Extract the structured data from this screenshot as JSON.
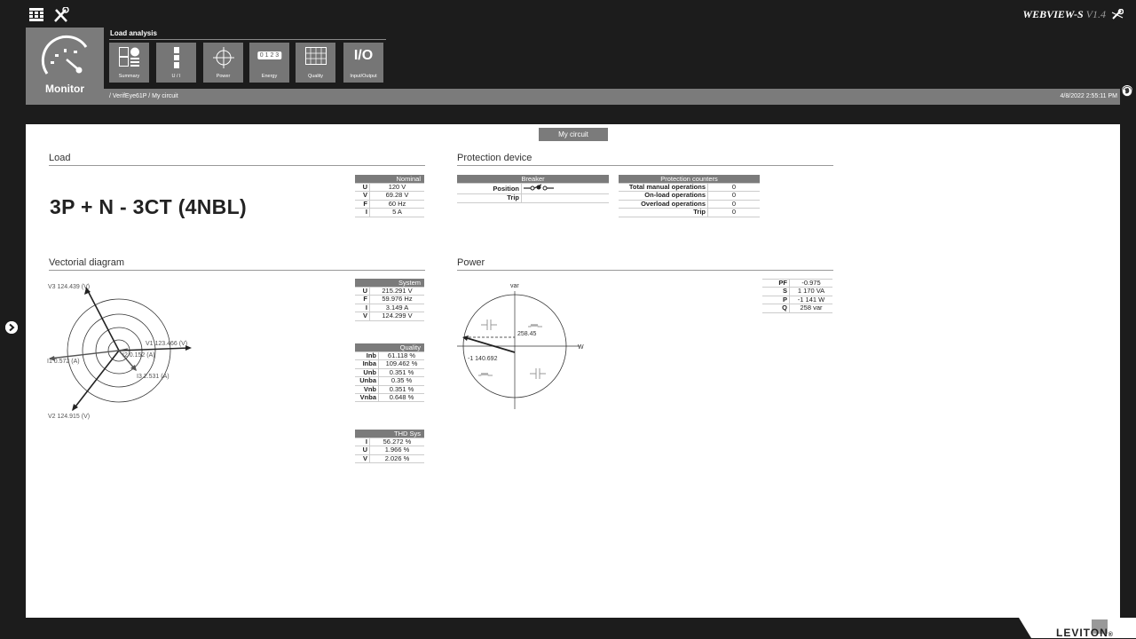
{
  "topbar": {
    "grid_icon": "grid-icon",
    "tools_icon": "tools-icon",
    "brand": "WEBVIEW-S",
    "version": "V1.4",
    "settings_icon": "wrench-icon"
  },
  "monitor": {
    "label": "Monitor",
    "icon": "gauge-icon"
  },
  "load_analysis": {
    "title": "Load analysis",
    "tools": [
      {
        "label": "Summary",
        "icon": "summary-icon"
      },
      {
        "label": "U / I",
        "icon": "ui-icon"
      },
      {
        "label": "Power",
        "icon": "power-icon"
      },
      {
        "label": "Energy",
        "icon": "energy-icon",
        "text": "0 1 2 3"
      },
      {
        "label": "Quality",
        "icon": "quality-icon"
      },
      {
        "label": "Input/Output",
        "icon": "io-icon",
        "text": "I/O"
      }
    ]
  },
  "breadcrumb": {
    "path": "/ VerifEye61P / My circuit",
    "datetime": "4/8/2022  2:55:11 PM"
  },
  "circuit_button": "My circuit",
  "load": {
    "heading": "Load",
    "config": "3P + N - 3CT (4NBL)",
    "nominal": {
      "header": "Nominal",
      "rows": [
        {
          "k": "U",
          "v": "120 V"
        },
        {
          "k": "V",
          "v": "69.28 V"
        },
        {
          "k": "F",
          "v": "60 Hz"
        },
        {
          "k": "I",
          "v": "5 A"
        }
      ]
    }
  },
  "protection": {
    "heading": "Protection device",
    "breaker": {
      "header": "Breaker",
      "rows": [
        {
          "k": "Position",
          "v": ""
        },
        {
          "k": "Trip",
          "v": ""
        }
      ]
    },
    "counters": {
      "header": "Protection counters",
      "rows": [
        {
          "k": "Total manual operations",
          "v": "0"
        },
        {
          "k": "On-load operations",
          "v": "0"
        },
        {
          "k": "Overload operations",
          "v": "0"
        },
        {
          "k": "Trip",
          "v": "0"
        }
      ]
    }
  },
  "vector": {
    "heading": "Vectorial diagram",
    "labels": {
      "v1": "V1  123.466  (V)",
      "v2": "V2  124.915  (V)",
      "v3": "V3  124.439  (V)",
      "i1": "I1  0.572  (A)",
      "i2": "I2  0.152  (A)",
      "i3": "I3  2.531  (A)"
    },
    "system": {
      "header": "System",
      "rows": [
        {
          "k": "U",
          "v": "215.291 V"
        },
        {
          "k": "F",
          "v": "59.976 Hz"
        },
        {
          "k": "I",
          "v": "3.149 A"
        },
        {
          "k": "V",
          "v": "124.299 V"
        }
      ]
    },
    "quality": {
      "header": "Quality",
      "rows": [
        {
          "k": "Inb",
          "v": "61.118 %"
        },
        {
          "k": "Inba",
          "v": "109.462 %"
        },
        {
          "k": "Unb",
          "v": "0.351 %"
        },
        {
          "k": "Unba",
          "v": "0.35 %"
        },
        {
          "k": "Vnb",
          "v": "0.351 %"
        },
        {
          "k": "Vnba",
          "v": "0.648 %"
        }
      ]
    },
    "thd": {
      "header": "THD Sys",
      "rows": [
        {
          "k": "I",
          "v": "56.272 %"
        },
        {
          "k": "U",
          "v": "1.966 %"
        },
        {
          "k": "V",
          "v": "2.026 %"
        }
      ]
    }
  },
  "power": {
    "heading": "Power",
    "axis_var": "var",
    "axis_w": "W",
    "p_value": "-1 140.692",
    "q_value": "258.45",
    "table": {
      "rows": [
        {
          "k": "PF",
          "v": "-0.975"
        },
        {
          "k": "S",
          "v": "1 170 VA"
        },
        {
          "k": "P",
          "v": "-1 141 W"
        },
        {
          "k": "Q",
          "v": "258 var"
        }
      ]
    }
  },
  "footer": {
    "logo": "LEVITON",
    "reg": "®"
  }
}
